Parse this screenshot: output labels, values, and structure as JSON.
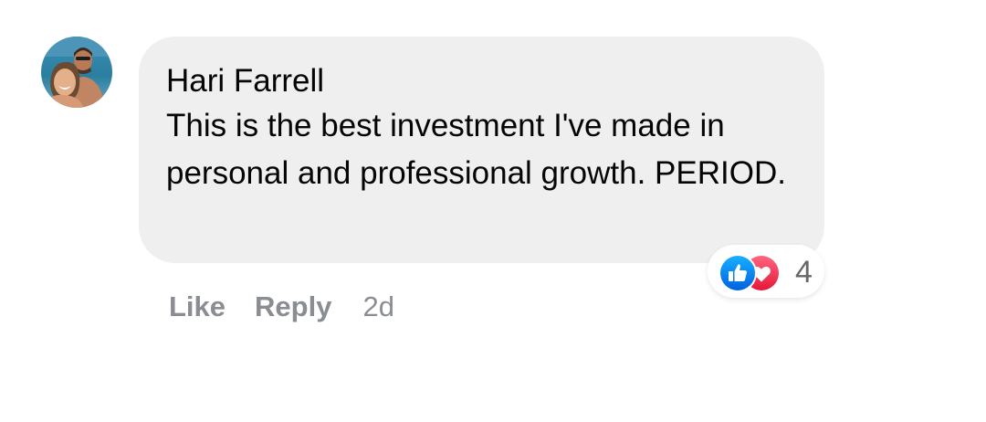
{
  "comment": {
    "author": "Hari Farrell",
    "text": "This is the best investment I've made in personal and professional growth. PERIOD.",
    "avatar_icon": "profile-photo"
  },
  "reactions": {
    "icons": [
      "like-icon",
      "love-icon"
    ],
    "count": "4",
    "like_color": "#1877f2",
    "love_color": "#f33e58"
  },
  "actions": {
    "like_label": "Like",
    "reply_label": "Reply",
    "time": "2d"
  }
}
